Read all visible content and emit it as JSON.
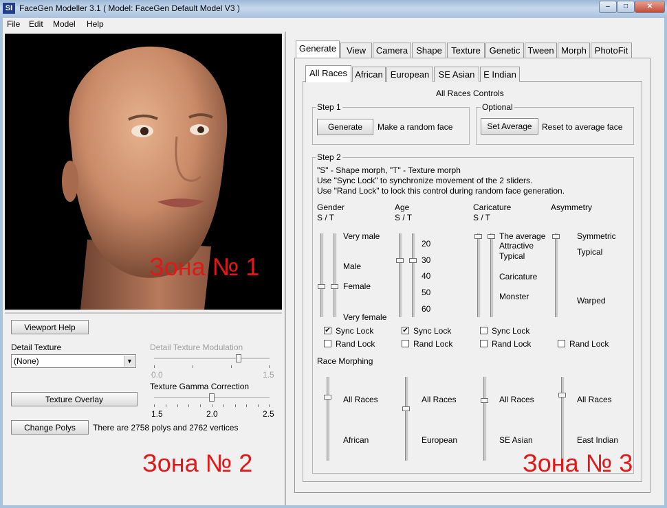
{
  "window": {
    "app_icon": "SI",
    "title": "FaceGen Modeller 3.1  ( Model: FaceGen Default Model V3 )",
    "controls": {
      "minimize": "–",
      "maximize": "□",
      "close": "✕"
    }
  },
  "menu": {
    "items": [
      "File",
      "Edit",
      "Model",
      "Help"
    ]
  },
  "zones": {
    "zone1": "Зона № 1",
    "zone2": "Зона № 2",
    "zone3": "Зона № 3"
  },
  "left_panel": {
    "viewport_help": "Viewport Help",
    "detail_texture_label": "Detail Texture",
    "detail_texture_value": "(None)",
    "detail_modulation": {
      "label": "Detail Texture Modulation",
      "min": "0.0",
      "max": "1.5",
      "value": 1.1
    },
    "texture_overlay": "Texture Overlay",
    "gamma": {
      "label": "Texture Gamma Correction",
      "t1": "1.5",
      "t2": "2.0",
      "t3": "2.5",
      "value": 2.0
    },
    "change_polys": "Change Polys",
    "polys_info": "There are 2758 polys and 2762 vertices"
  },
  "main_tabs": [
    "Generate",
    "View",
    "Camera",
    "Shape",
    "Texture",
    "Genetic",
    "Tween",
    "Morph",
    "PhotoFit"
  ],
  "race_tabs": [
    "All Races",
    "African",
    "European",
    "SE Asian",
    "E Indian"
  ],
  "generate": {
    "controls_title": "All Races Controls",
    "step1": {
      "title": "Step 1",
      "button": "Generate",
      "desc": "Make a random face"
    },
    "optional": {
      "title": "Optional",
      "button": "Set Average",
      "desc": "Reset to average face"
    },
    "step2": {
      "title": "Step 2",
      "line1": "\"S\" - Shape morph, \"T\" - Texture morph",
      "line2": "Use \"Sync Lock\" to synchronize movement of the 2 sliders.",
      "line3": "Use \"Rand Lock\" to lock this control during random face generation."
    },
    "columns": {
      "gender": {
        "title": "Gender",
        "st": "S / T",
        "labels": [
          "Very male",
          "Male",
          "Female",
          "Very female"
        ]
      },
      "age": {
        "title": "Age",
        "st": "S / T",
        "labels": [
          "20",
          "30",
          "40",
          "50",
          "60"
        ]
      },
      "caricature": {
        "title": "Caricature",
        "st": "S / T",
        "labels": [
          "The average",
          "Attractive",
          "Typical",
          "Caricature",
          "Monster"
        ]
      },
      "asymmetry": {
        "title": "Asymmetry",
        "labels": [
          "Symmetric",
          "Typical",
          "Warped"
        ]
      }
    },
    "sync_lock": "Sync Lock",
    "rand_lock": "Rand Lock",
    "sync_checked": [
      true,
      true,
      false
    ],
    "race_morphing": {
      "title": "Race Morphing",
      "pairs": [
        {
          "top": "All Races",
          "bottom": "African"
        },
        {
          "top": "All Races",
          "bottom": "European"
        },
        {
          "top": "All Races",
          "bottom": "SE Asian"
        },
        {
          "top": "All Races",
          "bottom": "East Indian"
        }
      ]
    }
  }
}
